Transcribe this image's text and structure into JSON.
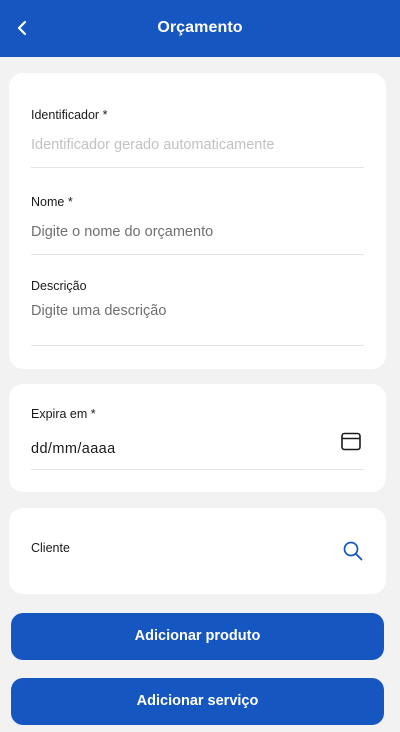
{
  "header": {
    "title": "Orçamento",
    "back_icon": "chevron-left-icon",
    "background": "#1556c0"
  },
  "form": {
    "identificador": {
      "label": "Identificador *",
      "placeholder": "Identificador gerado automaticamente"
    },
    "nome": {
      "label": "Nome *",
      "placeholder": "Digite o nome do orçamento"
    },
    "descricao": {
      "label": "Descrição",
      "placeholder": "Digite uma descrição"
    },
    "expira_em": {
      "label": "Expira em *",
      "value": "dd/mm/aaaa",
      "icon": "calendar-icon"
    },
    "cliente": {
      "label": "Cliente",
      "icon": "search-icon"
    }
  },
  "actions": {
    "add_product_label": "Adicionar produto",
    "add_service_label": "Adicionar serviço"
  },
  "colors": {
    "primary": "#1556c0",
    "background": "#f2f2f2",
    "card": "#ffffff"
  }
}
